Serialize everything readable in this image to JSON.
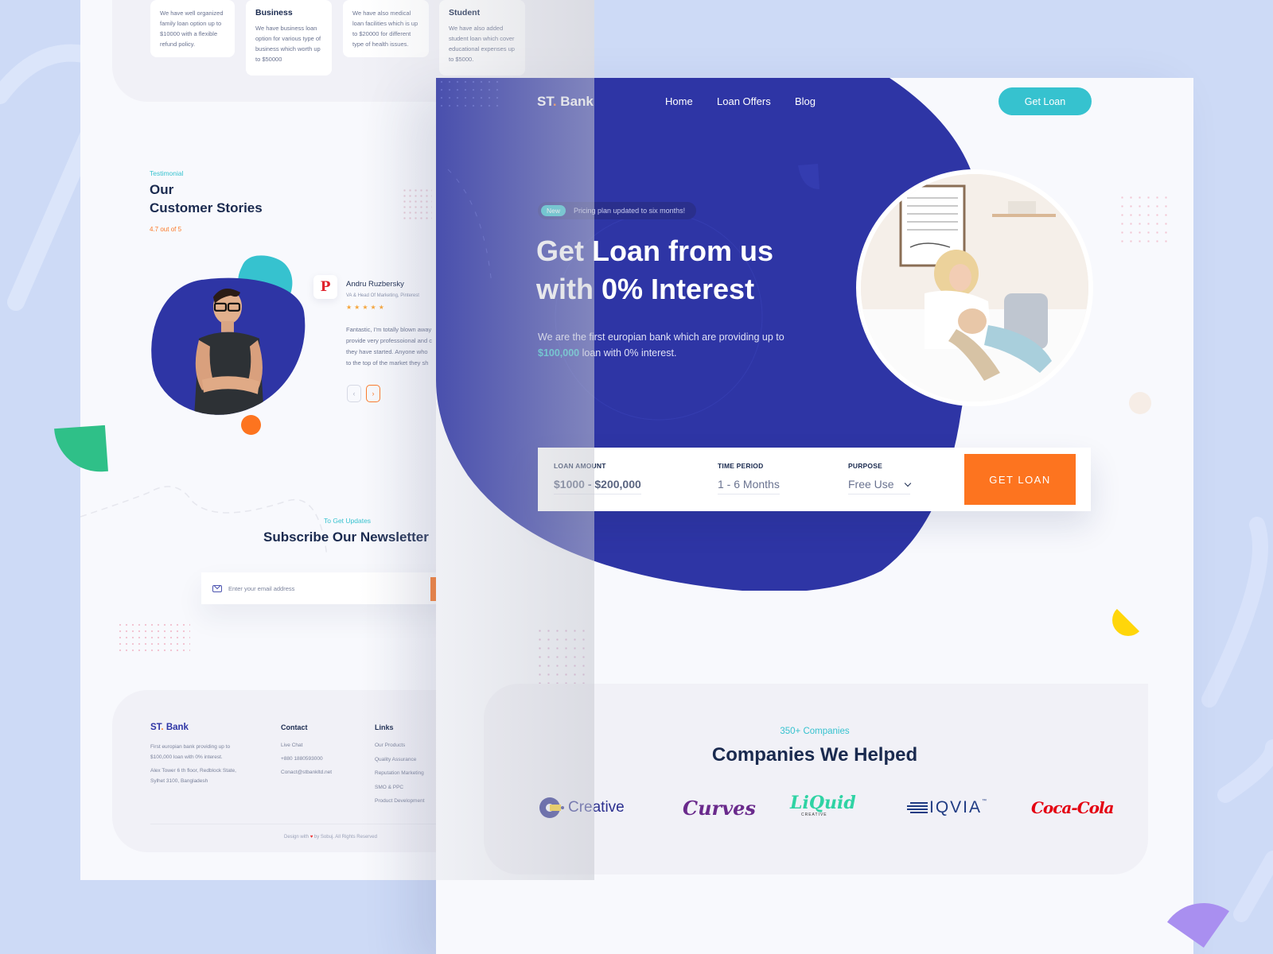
{
  "left_page": {
    "loan_cards": [
      {
        "title": "",
        "text": [
          "We have well organized",
          "family loan option up to",
          "$10000 with a flexible",
          "refund policy."
        ]
      },
      {
        "title": "Business",
        "text": [
          "We have business loan",
          "option for various type of",
          "business which worth up",
          "to $50000"
        ]
      },
      {
        "title": "",
        "text": [
          "We have also medical",
          "loan facilities which is up",
          "to $20000 for different",
          "type of health issues."
        ]
      },
      {
        "title": "Student",
        "text": [
          "We have also added",
          "student loan which cover",
          "educational expenses up",
          "to $5000."
        ]
      }
    ],
    "testimonial": {
      "eyebrow": "Testimonial",
      "title_line1": "Our",
      "title_line2": "Customer Stories",
      "rating": "4.7 out of 5",
      "reviewer_name": "Andru Ruzbersky",
      "reviewer_role": "VA & Head Of Marketing, Pinterest",
      "stars": "★★★★★",
      "star_count": 5,
      "review_lines": [
        "Fantastic, I'm totally blown away",
        "provide very professoional and c",
        "they have started. Anyone who",
        "to the top of the market  they sh"
      ],
      "prev_icon": "‹",
      "next_icon": "›",
      "brand_icon": "P"
    },
    "newsletter": {
      "eyebrow": "To Get Updates",
      "title": "Subscribe Our Newsletter",
      "email_placeholder": "Enter your email address"
    },
    "footer": {
      "logo_main": "ST",
      "logo_dot": ".",
      "logo_rest": " Bank",
      "about_lines": [
        "First europian bank providing up to",
        "$100,000 loan with 0% interest."
      ],
      "address_lines": [
        "Alex Tower 6 th floor, Redblock State,",
        "Sylhet 3100, Bangladesh"
      ],
      "contact_heading": "Contact",
      "contact_items": [
        "Live Chat",
        "+880 1880593000",
        "Conact@stbankltd.net"
      ],
      "links_heading": "Links",
      "link_items": [
        "Our Products",
        "Quality Assurance",
        "Reputation Marketing",
        "SMO & PPC",
        "Product Development"
      ],
      "copyright_pre": "Design with",
      "copyright_heart": "♥",
      "copyright_post": "by Sobuj. All Rights Reserved"
    }
  },
  "right_page": {
    "nav": {
      "logo_main": "ST",
      "logo_dot": ".",
      "logo_rest": " Bank",
      "links": [
        "Home",
        "Loan Offers",
        "Blog"
      ],
      "cta": "Get Loan"
    },
    "hero": {
      "badge_new": "New",
      "badge_text": "Pricing plan updated to six months!",
      "title_line1": "Get Loan from us",
      "title_line2": "with 0% Interest",
      "desc_line1": "We are the first europian bank which are providing up to",
      "desc_highlight": "$100,000",
      "desc_line2_rest": " loan with 0% interest."
    },
    "loan_form": {
      "amount_label": "LOAN AMOUNT",
      "amount_value": "$1000 - $200,000",
      "period_label": "TIME PERIOD",
      "period_value": "1 - 6 Months",
      "purpose_label": "PURPOSE",
      "purpose_value": "Free Use",
      "submit": "GET LOAN"
    },
    "companies": {
      "eyebrow": "350+ Companies",
      "title": "Companies We Helped",
      "logos": [
        "Creative",
        "Curves",
        "LiQuid",
        "IQVIA",
        "Coca-Cola"
      ],
      "liquid_sub": "CREATIVE",
      "iqvia_tm": "™"
    }
  },
  "colors": {
    "primary": "#2e35a5",
    "accent_teal": "#36c2cf",
    "accent_orange": "#fd741f",
    "text_dark": "#1a2a4f",
    "background": "#cddaf6"
  }
}
